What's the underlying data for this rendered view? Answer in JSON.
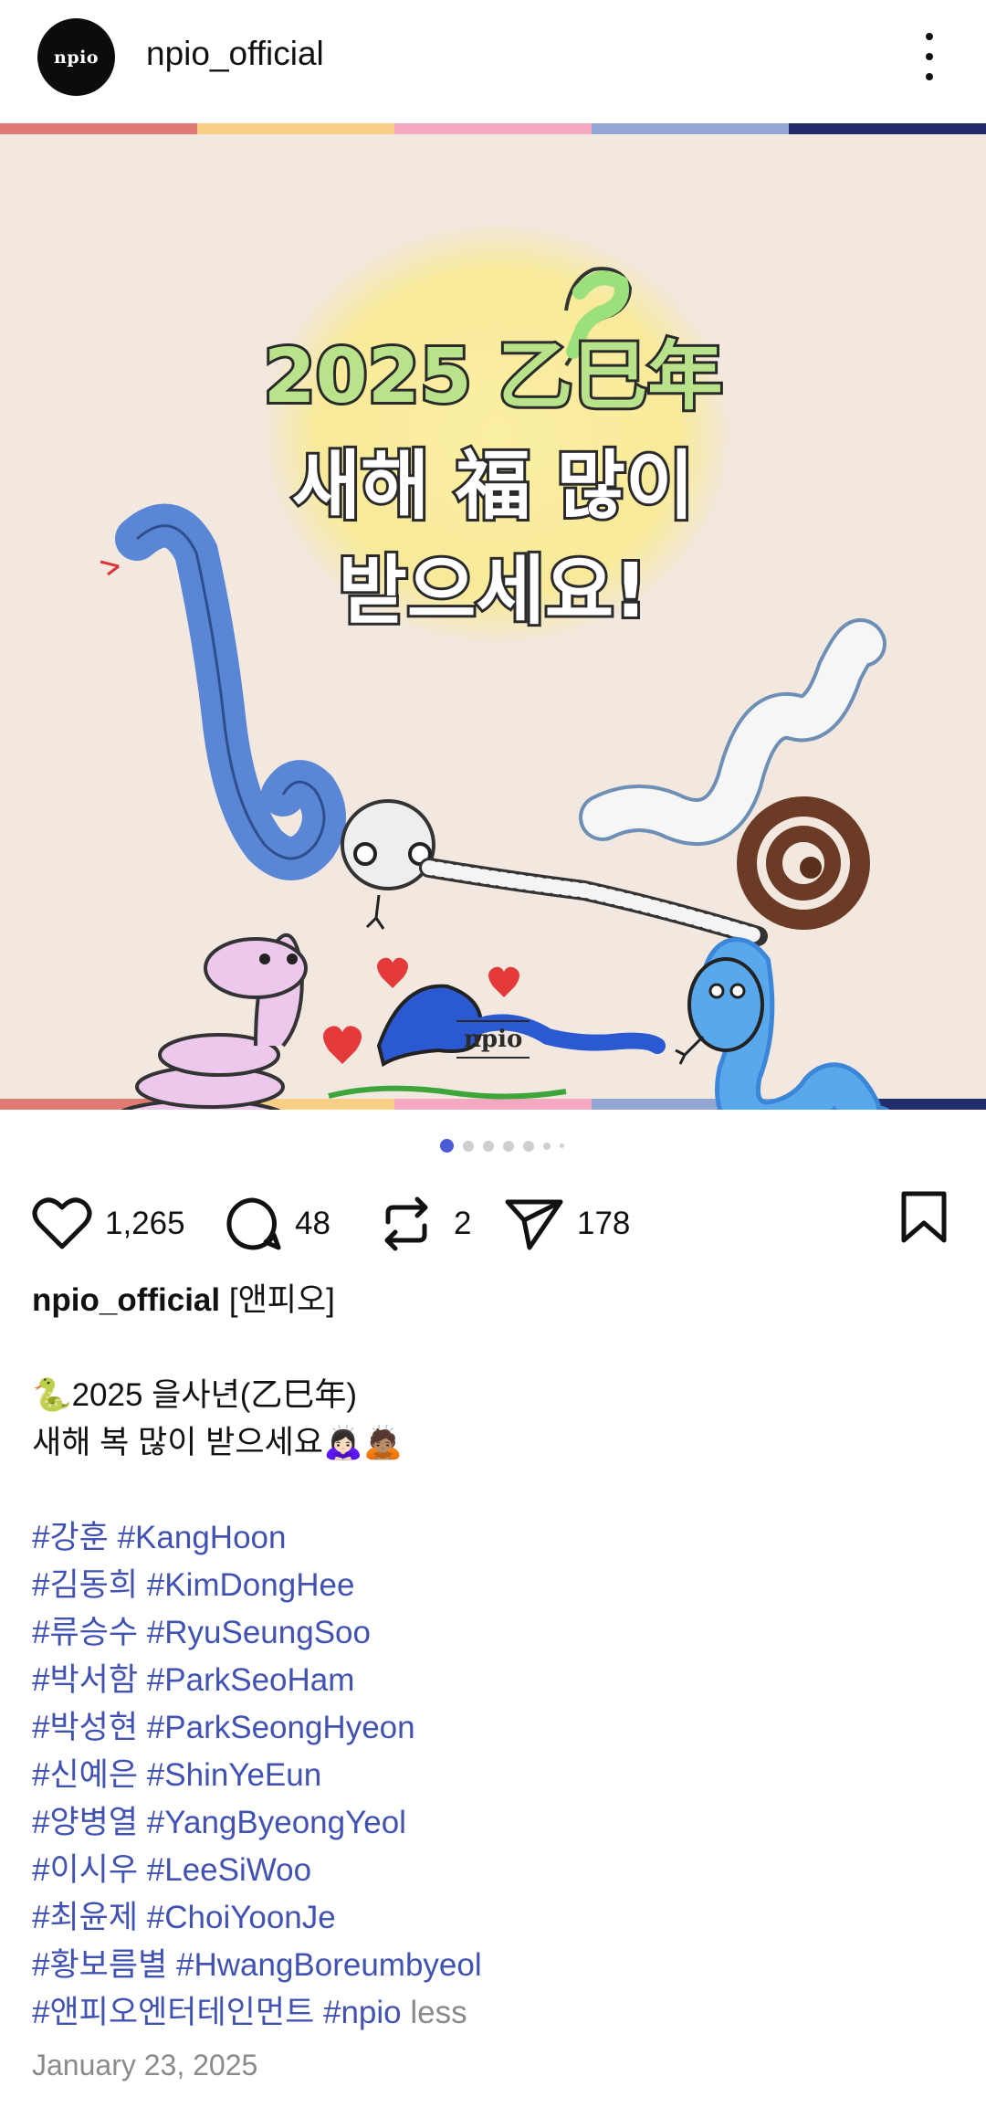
{
  "header": {
    "avatar_text": "npio",
    "username": "npio_official"
  },
  "post_image": {
    "headline_line1": "2025 乙巳年",
    "headline_line2": "새해 福 많이",
    "headline_line3": "받으세요!",
    "brand_mark": "npio",
    "stripe_colors": [
      "#e07a74",
      "#f8cf86",
      "#f3a9c0",
      "#93a6d4",
      "#232c6b"
    ],
    "background_color": "#f2e8e0"
  },
  "carousel": {
    "total_dots": 7,
    "active_index": 0
  },
  "actions": {
    "likes": "1,265",
    "comments": "48",
    "reposts": "2",
    "shares": "178"
  },
  "caption": {
    "username": "npio_official",
    "name_tag": "[앤피오]",
    "line1": "🐍2025 을사년(乙巳年)",
    "line2": "새해 복 많이 받으세요🙇🏻‍♀️🙇🏽",
    "hashtags": [
      "#강훈 #KangHoon",
      "#김동희 #KimDongHee",
      "#류승수 #RyuSeungSoo",
      "#박서함 #ParkSeoHam",
      "#박성현 #ParkSeongHyeon",
      "#신예은 #ShinYeEun",
      "#양병열 #YangByeongYeol",
      "#이시우 #LeeSiWoo",
      "#최윤제 #ChoiYoonJe",
      "#황보름별 #HwangBoreumbyeol",
      "#앤피오엔터테인먼트 #npio"
    ],
    "less_label": "less"
  },
  "date": "January 23, 2025",
  "colors": {
    "hashtag": "#4152b3",
    "muted": "#8a8a8a",
    "active_dot": "#4a5bd6"
  }
}
